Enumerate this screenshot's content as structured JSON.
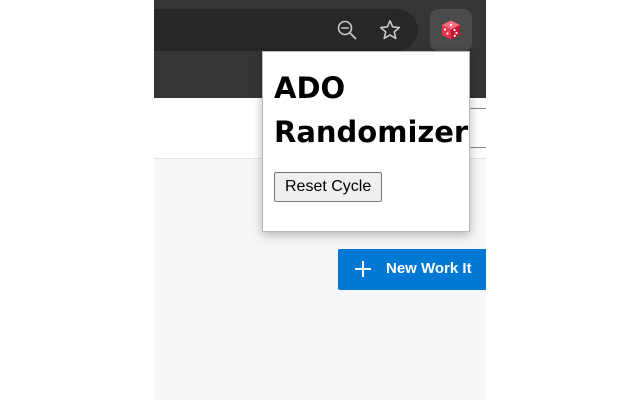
{
  "popup": {
    "title": "ADO Randomizer",
    "reset_button_label": "Reset Cycle"
  },
  "page": {
    "new_work_item_label": "New Work It"
  },
  "toolbar": {
    "icons": [
      "zoom-out-icon",
      "star-icon",
      "dice-icon"
    ]
  },
  "colors": {
    "toolbar_bg": "#353535",
    "omnibox_bg": "#272727",
    "accent": "#0078d4",
    "dice": "#e8334a"
  }
}
